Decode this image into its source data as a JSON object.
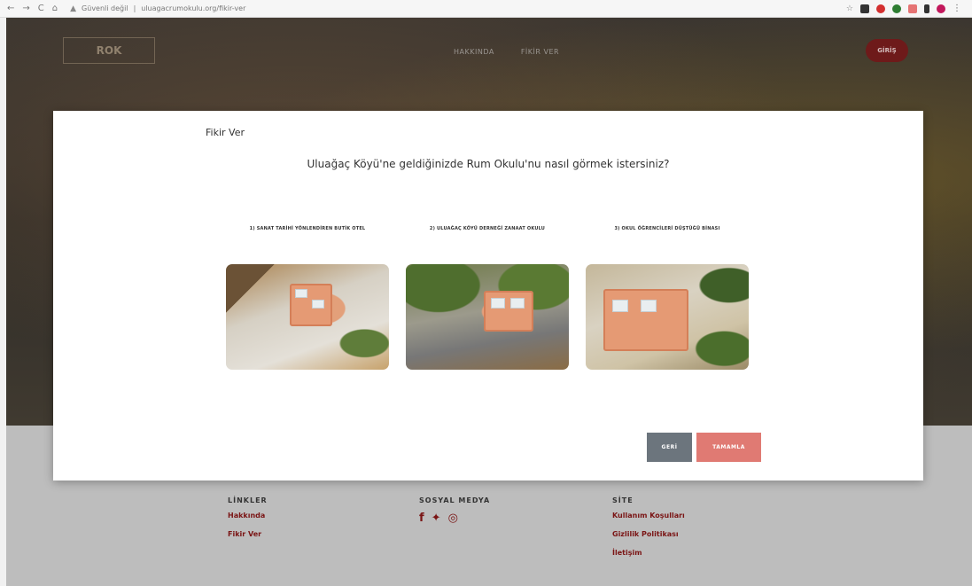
{
  "browser": {
    "nav_back": "←",
    "nav_forward": "→",
    "nav_reload": "C",
    "nav_home": "⌂",
    "url_security": "Güvenli değil",
    "url_text": "uluagacrumokulu.org/fikir-ver"
  },
  "site_header": {
    "logo_text": "ROK",
    "menu": [
      "HAKKINDA",
      "FİKİR VER"
    ],
    "login_label": "GİRİŞ"
  },
  "modal": {
    "title": "Fikir Ver",
    "question": "Uluağaç Köyü'ne geldiğinizde Rum Okulu'nu nasıl görmek istersiniz?",
    "options": [
      {
        "label": "1) SANAT TARİHİ YÖNLENDİREN BUTİK OTEL"
      },
      {
        "label": "2) ULUAĞAÇ KÖYÜ DERNEĞİ ZANAAT OKULU"
      },
      {
        "label": "3) OKUL ÖĞRENCİLERİ DÜŞTÜĞÜ BİNASI"
      }
    ],
    "back_label": "GERİ",
    "finish_label": "TAMAMLA"
  },
  "footer": {
    "links_heading": "LİNKLER",
    "links": [
      "Hakkında",
      "Fikir Ver"
    ],
    "social_heading": "SOSYAL MEDYA",
    "social_icons": [
      "facebook-icon",
      "twitter-icon",
      "instagram-icon"
    ],
    "site_heading": "SİTE",
    "site_links": [
      "Kullanım Koşulları",
      "Gizlilik Politikası",
      "İletişim"
    ]
  },
  "colors": {
    "accent": "#7a1414",
    "finish_button": "#e07a73",
    "back_button": "#6c757d"
  }
}
